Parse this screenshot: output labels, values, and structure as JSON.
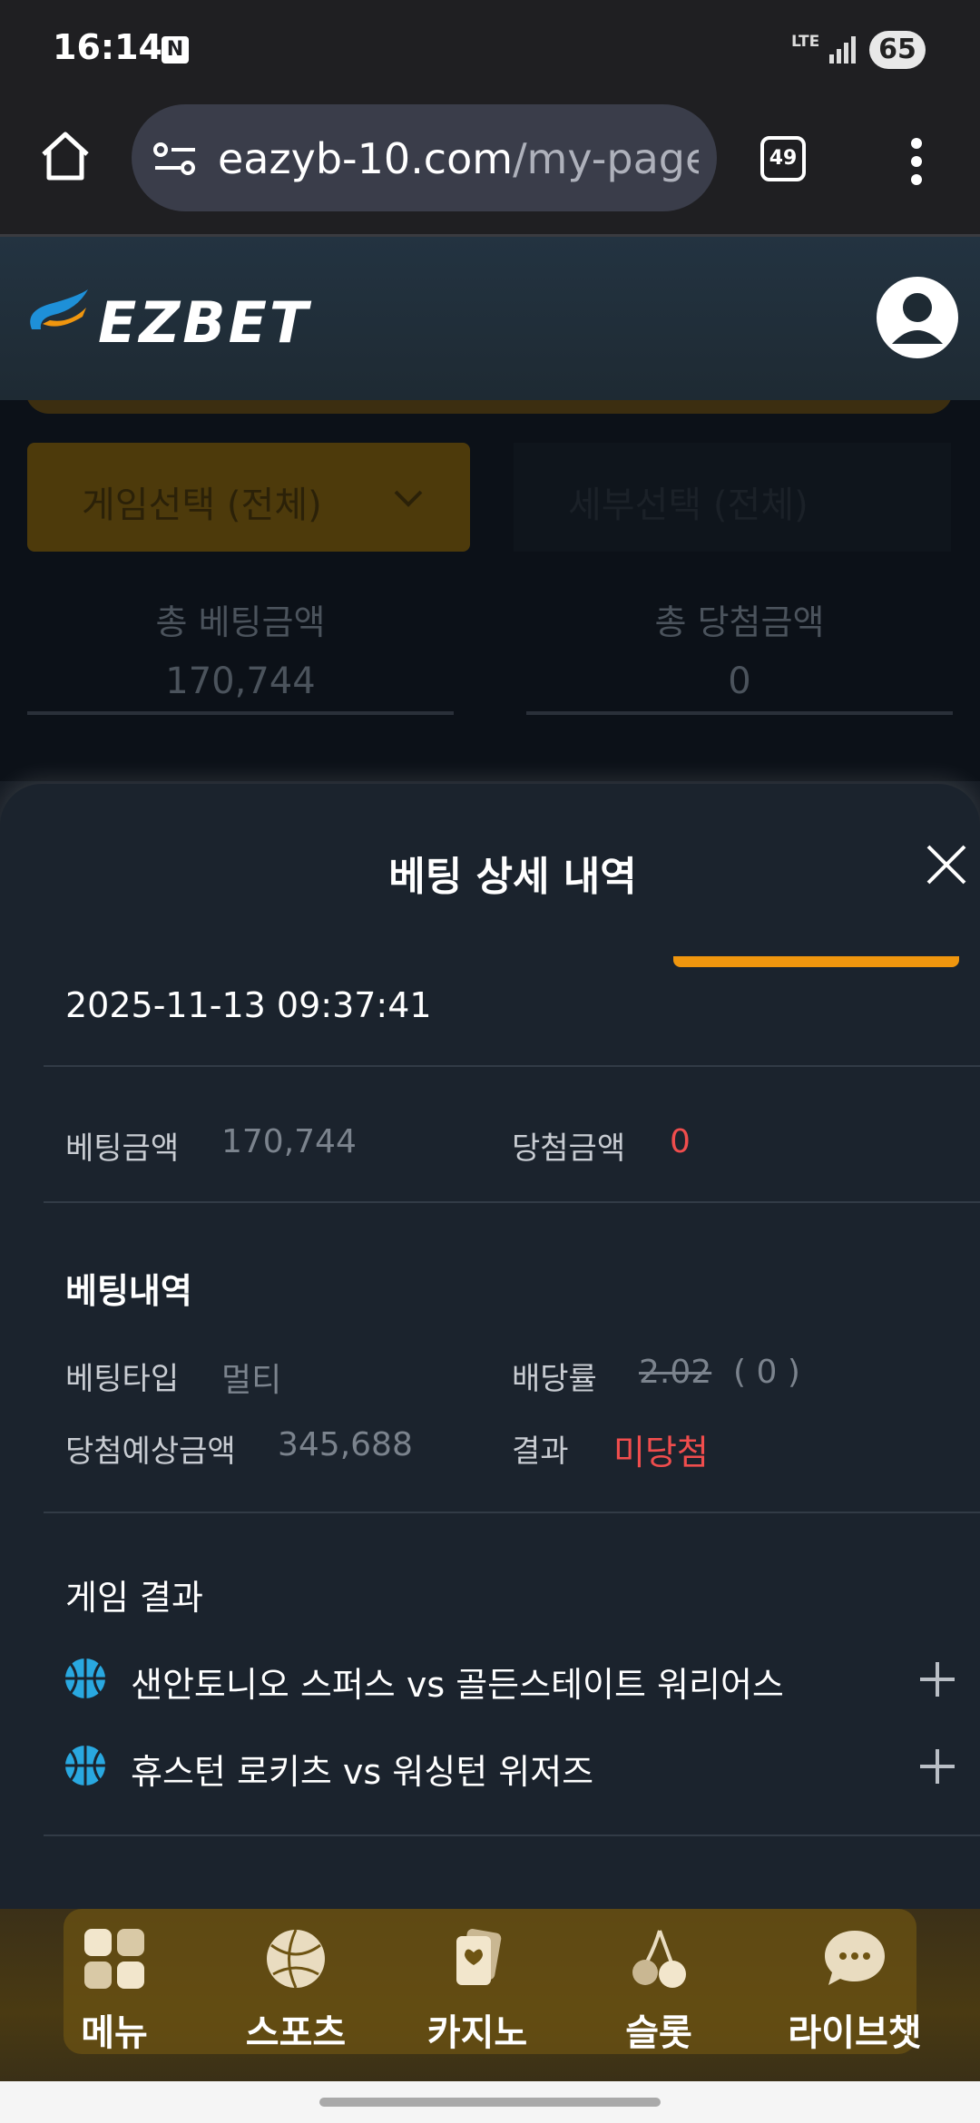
{
  "status_bar": {
    "time": "16:14",
    "network": "LTE",
    "battery": "65",
    "notification_badge": "N"
  },
  "browser": {
    "url_domain": "eazyb-10.com",
    "url_path": "/my-page/",
    "tab_count": "49"
  },
  "site": {
    "logo_text": "EZBET"
  },
  "background_page": {
    "game_select": "게임선택 (전체)",
    "detail_select": "세부선택 (전체)",
    "total_bet_label": "총 베팅금액",
    "total_bet_value": "170,744",
    "total_win_label": "총 당첨금액",
    "total_win_value": "0"
  },
  "modal": {
    "title": "베팅 상세 내역",
    "datetime": "2025-11-13 09:37:41",
    "bet_amount_label": "베팅금액",
    "bet_amount_value": "170,744",
    "win_amount_label": "당첨금액",
    "win_amount_value": "0",
    "bet_details_title": "베팅내역",
    "bet_type_label": "베팅타입",
    "bet_type_value": "멀티",
    "odds_label": "배당률",
    "odds_value": "2.02",
    "odds_result": "( 0 )",
    "expected_win_label": "당첨예상금액",
    "expected_win_value": "345,688",
    "result_label": "결과",
    "result_value": "미당첨",
    "game_results_title": "게임 결과",
    "matches": [
      {
        "name": "샌안토니오 스퍼스 vs 골든스테이트 워리어스"
      },
      {
        "name": "휴스턴 로키츠 vs 워싱턴 위저즈"
      }
    ]
  },
  "bottom_nav": [
    {
      "label": "메뉴",
      "icon": "grid-icon"
    },
    {
      "label": "스포츠",
      "icon": "basketball-icon"
    },
    {
      "label": "카지노",
      "icon": "cards-icon"
    },
    {
      "label": "슬롯",
      "icon": "cherry-icon"
    },
    {
      "label": "라이브챗",
      "icon": "chat-icon"
    }
  ],
  "colors": {
    "accent": "#f0960e",
    "loss_red": "#f04d4d",
    "background": "#1b232d"
  }
}
